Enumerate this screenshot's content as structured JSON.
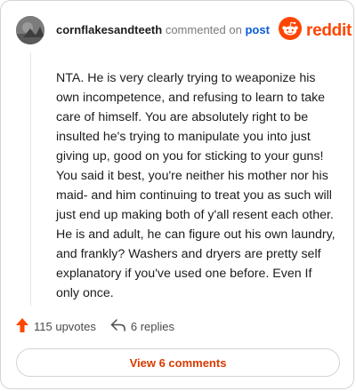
{
  "comment": {
    "username": "cornflakesandteeth",
    "action_text": "commented on",
    "post_link": "post",
    "body": "NTA. He is very clearly trying to weaponize his own incompetence, and refusing to learn to take care of himself. You are absolutely right to be insulted he's trying to manipulate you into just giving up, good on you for sticking to your guns! You said it best, you're neither his mother nor his maid- and him continuing to treat you as such will just end up making both of y'all resent each other. He is and adult, he can figure out his own laundry, and frankly? Washers and dryers are pretty self explanatory if you've used one before. Even If only once."
  },
  "branding": {
    "logo_text": "reddit",
    "color": "#ff4500"
  },
  "actions": {
    "upvotes_label": "115 upvotes",
    "replies_label": "6 replies",
    "upvote_color": "#ff4500"
  },
  "view_comments": {
    "label": "View 6 comments"
  },
  "icons": {
    "avatar": "user-avatar",
    "logo": "reddit-snoo-icon",
    "upvote": "upvote-arrow-icon",
    "reply": "reply-arrow-icon"
  }
}
